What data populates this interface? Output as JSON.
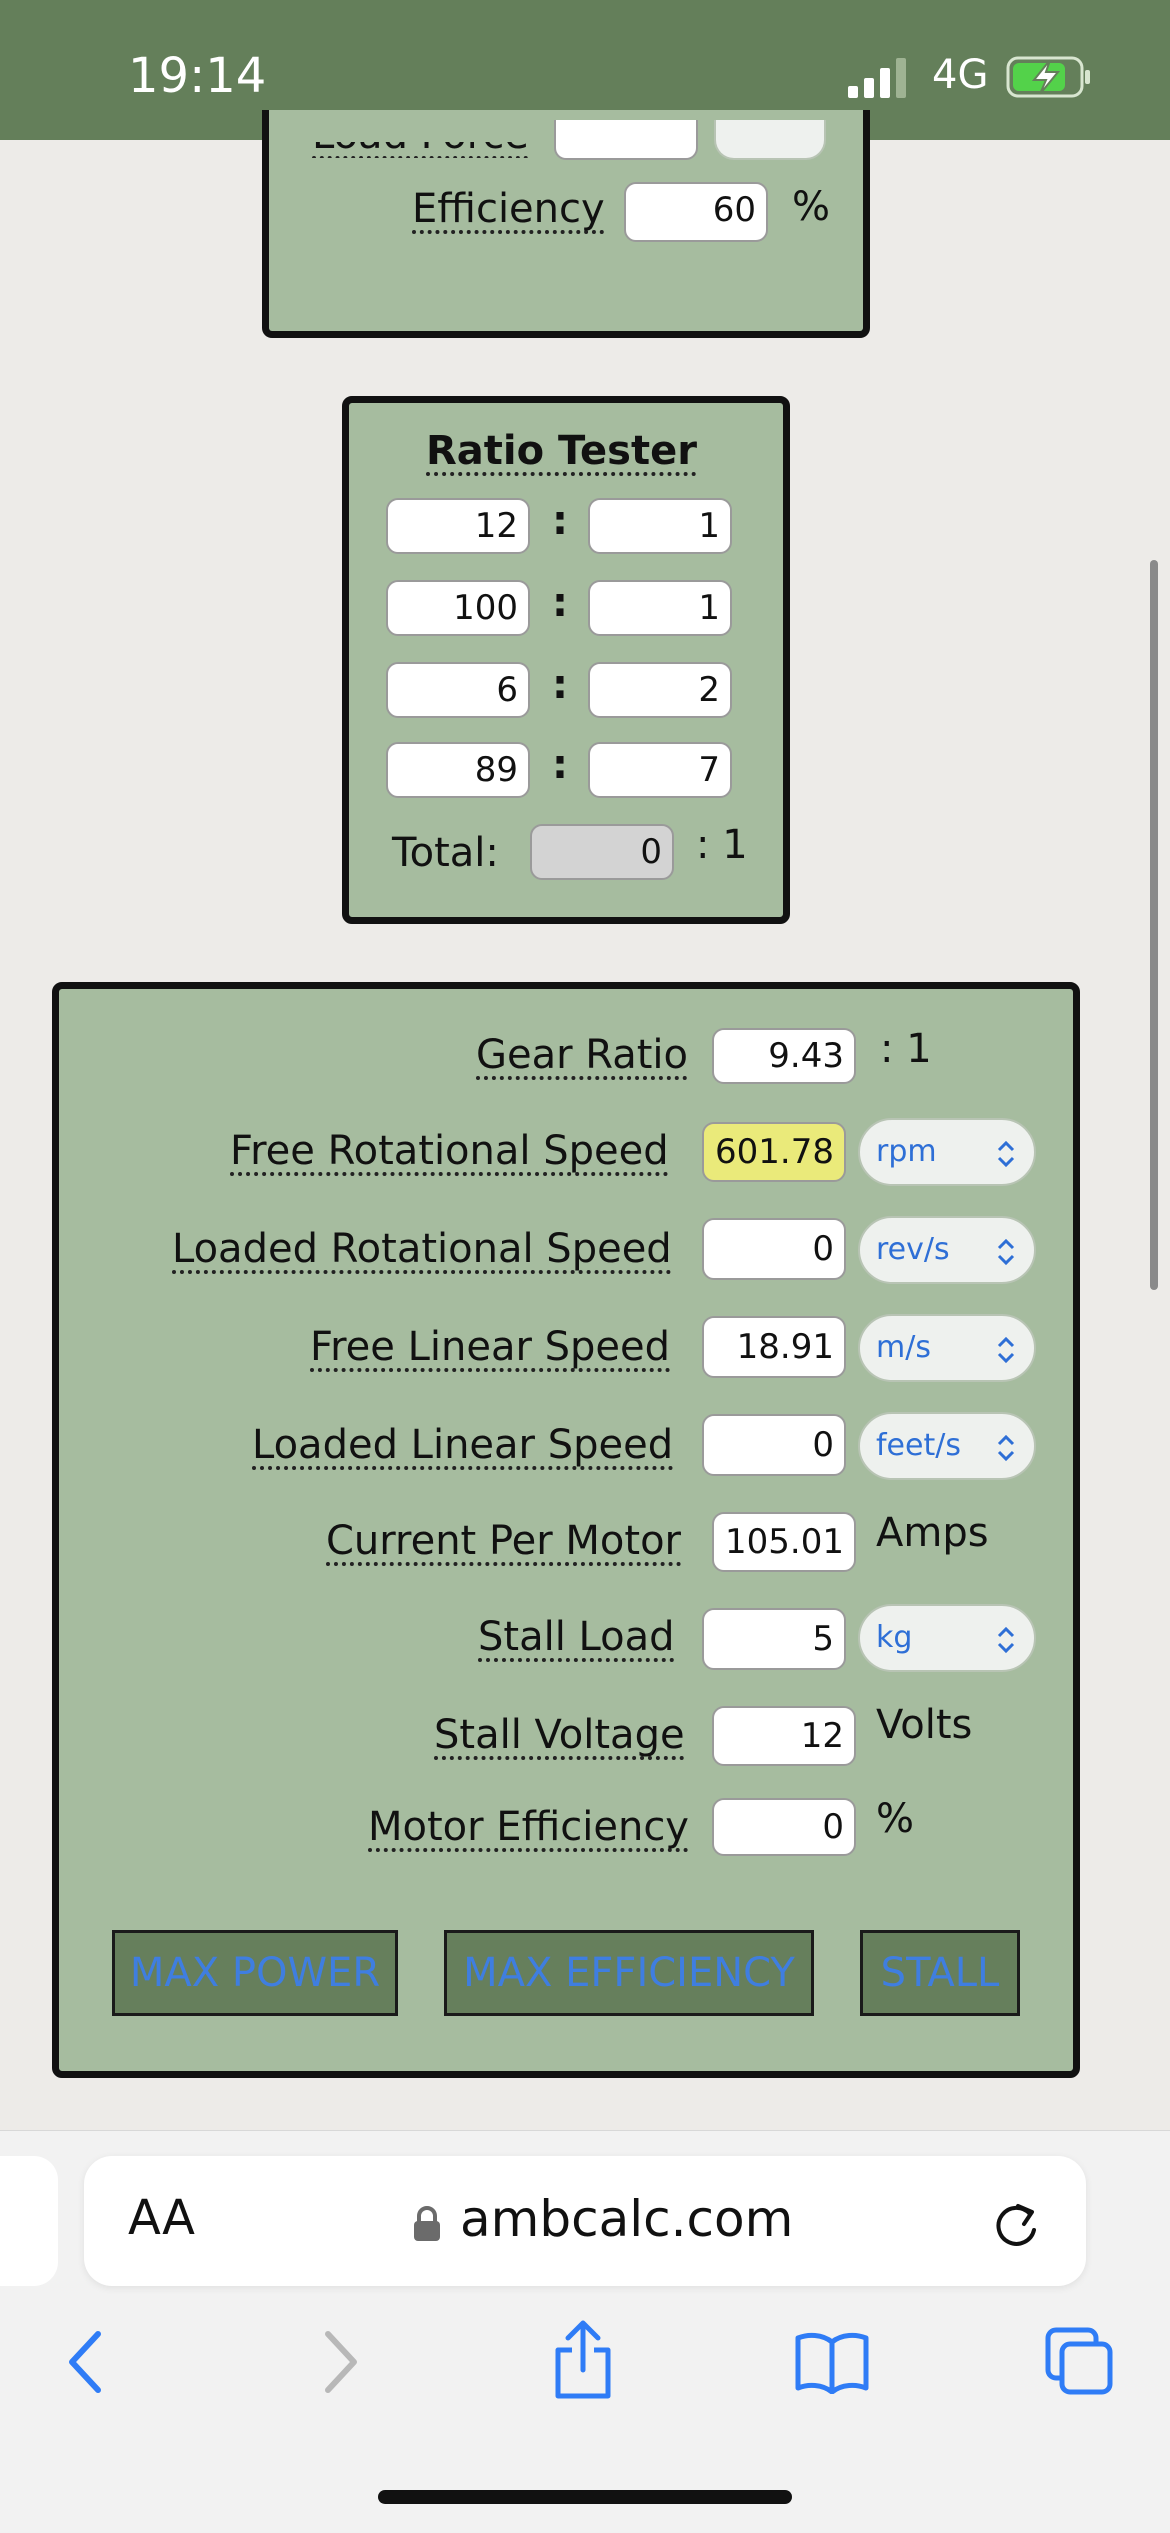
{
  "status": {
    "time": "19:14",
    "network": "4G"
  },
  "top_panel": {
    "partial_label": "Load Force",
    "efficiency_label": "Efficiency",
    "efficiency_value": "60",
    "efficiency_unit": "%"
  },
  "ratio_tester": {
    "title": "Ratio Tester",
    "rows": [
      {
        "left": "12",
        "right": "1"
      },
      {
        "left": "100",
        "right": "1"
      },
      {
        "left": "6",
        "right": "2"
      },
      {
        "left": "89",
        "right": "7"
      }
    ],
    "separator": ":",
    "total_label": "Total:",
    "total_value": "0",
    "total_suffix": ": 1"
  },
  "calc": {
    "gear_ratio": {
      "label": "Gear Ratio",
      "value": "9.43",
      "suffix": ": 1"
    },
    "free_rot_speed": {
      "label": "Free Rotational Speed",
      "value": "601.78",
      "unit": "rpm"
    },
    "loaded_rot_speed": {
      "label": "Loaded Rotational Speed",
      "value": "0",
      "unit": "rev/s"
    },
    "free_lin_speed": {
      "label": "Free Linear Speed",
      "value": "18.91",
      "unit": "m/s"
    },
    "loaded_lin_speed": {
      "label": "Loaded Linear Speed",
      "value": "0",
      "unit": "feet/s"
    },
    "current_per_motor": {
      "label": "Current Per Motor",
      "value": "105.01",
      "unit": "Amps"
    },
    "stall_load": {
      "label": "Stall Load",
      "value": "5",
      "unit": "kg"
    },
    "stall_voltage": {
      "label": "Stall Voltage",
      "value": "12",
      "unit": "Volts"
    },
    "motor_efficiency": {
      "label": "Motor Efficiency",
      "value": "0",
      "unit": "%"
    },
    "buttons": {
      "max_power": "MAX POWER",
      "max_efficiency": "MAX EFFICIENCY",
      "stall": "STALL"
    }
  },
  "browser": {
    "aa": "AA",
    "url": "ambcalc.com"
  },
  "colors": {
    "panel": "#a6bc9f",
    "status_bar": "#647f5a",
    "highlight": "#eaea7a",
    "link_blue": "#2e6fd6"
  }
}
